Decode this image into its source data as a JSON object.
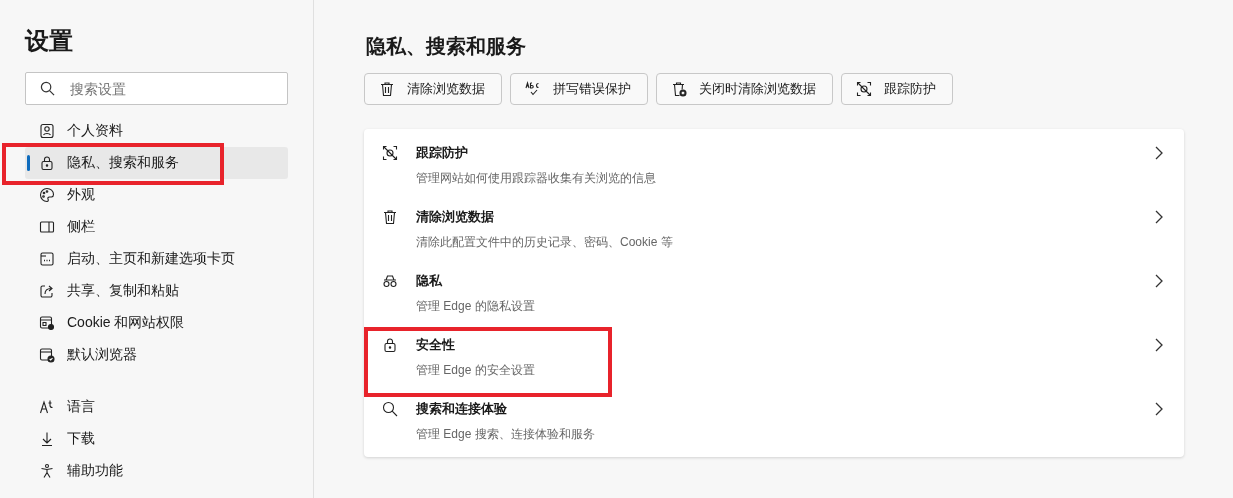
{
  "sidebar": {
    "title": "设置",
    "search": {
      "placeholder": "搜索设置"
    },
    "groups": [
      {
        "items": [
          {
            "label": "个人资料",
            "selected": false,
            "annotated": false
          },
          {
            "label": "隐私、搜索和服务",
            "selected": true,
            "annotated": true
          },
          {
            "label": "外观",
            "selected": false,
            "annotated": false
          },
          {
            "label": "侧栏",
            "selected": false,
            "annotated": false
          },
          {
            "label": "启动、主页和新建选项卡页",
            "selected": false,
            "annotated": false
          },
          {
            "label": "共享、复制和粘贴",
            "selected": false,
            "annotated": false
          },
          {
            "label": "Cookie 和网站权限",
            "selected": false,
            "annotated": false
          },
          {
            "label": "默认浏览器",
            "selected": false,
            "annotated": false
          }
        ]
      },
      {
        "items": [
          {
            "label": "语言",
            "selected": false,
            "annotated": false
          },
          {
            "label": "下载",
            "selected": false,
            "annotated": false
          },
          {
            "label": "辅助功能",
            "selected": false,
            "annotated": false
          }
        ]
      }
    ]
  },
  "main": {
    "title": "隐私、搜索和服务",
    "quick_buttons": [
      {
        "label": "清除浏览数据"
      },
      {
        "label": "拼写错误保护"
      },
      {
        "label": "关闭时清除浏览数据"
      },
      {
        "label": "跟踪防护"
      }
    ],
    "rows": [
      {
        "title": "跟踪防护",
        "description": "管理网站如何使用跟踪器收集有关浏览的信息",
        "annotated": false
      },
      {
        "title": "清除浏览数据",
        "description": "清除此配置文件中的历史记录、密码、Cookie 等",
        "annotated": false
      },
      {
        "title": "隐私",
        "description": "管理 Edge 的隐私设置",
        "annotated": false
      },
      {
        "title": "安全性",
        "description": "管理 Edge 的安全设置",
        "annotated": true
      },
      {
        "title": "搜索和连接体验",
        "description": "管理 Edge 搜索、连接体验和服务",
        "annotated": false
      }
    ]
  }
}
